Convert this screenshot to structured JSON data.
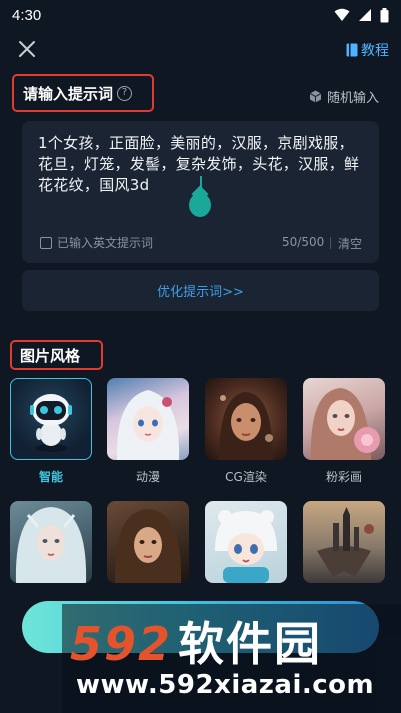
{
  "status_bar": {
    "time": "4:30"
  },
  "topbar": {
    "tutorial_label": "教程"
  },
  "prompt": {
    "title": "请输入提示词",
    "random_label": "随机输入",
    "text": "1个女孩，正面脸，美丽的，汉服，京剧戏服，花旦，灯笼，发髻，复杂发饰，头花，汉服，鲜花花纹，国风3d",
    "english_check_label": "已输入英文提示词",
    "char_count": "50/500",
    "clear_label": "清空",
    "optimize_label": "优化提示词>>"
  },
  "styles": {
    "title": "图片风格",
    "items": [
      {
        "label": "智能",
        "icon": "robot-icon",
        "selected": true
      },
      {
        "label": "动漫",
        "selected": false
      },
      {
        "label": "CG渲染",
        "selected": false
      },
      {
        "label": "粉彩画",
        "selected": false
      },
      {
        "label": "",
        "selected": false
      },
      {
        "label": "",
        "selected": false
      },
      {
        "label": "",
        "selected": false
      },
      {
        "label": "",
        "selected": false
      }
    ]
  },
  "watermark": {
    "logo_digits": "592",
    "logo_cn": "软件园",
    "url": "www.592xiazai.com"
  },
  "colors": {
    "accent": "#3ec6e0",
    "highlight_border": "#e23a2f",
    "link": "#4fb3ff"
  }
}
